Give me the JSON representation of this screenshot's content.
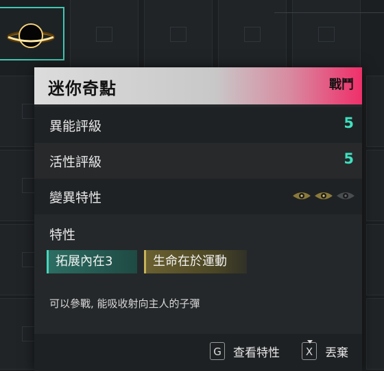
{
  "item": {
    "name": "迷你奇點",
    "tag": "戰鬥"
  },
  "stats": [
    {
      "label": "異能評級",
      "value": "5"
    },
    {
      "label": "活性評級",
      "value": "5"
    },
    {
      "label": "變異特性",
      "eyes_active": 2,
      "eyes_total": 3
    }
  ],
  "traits": {
    "title": "特性",
    "chips": [
      {
        "label": "拓展內在3",
        "color": "#2c6d62"
      },
      {
        "label": "生命在於運動",
        "color": "#6a6030"
      }
    ]
  },
  "description": "可以參戰, 能吸收射向主人的子彈",
  "footer": {
    "actions": [
      {
        "key": "G",
        "label": "查看特性"
      },
      {
        "key": "X",
        "label": "丟棄"
      }
    ]
  },
  "colors": {
    "accent_teal": "#3fe0c0",
    "header_pink": "#ee2f6a",
    "eye_gold": "#c9b35a"
  }
}
